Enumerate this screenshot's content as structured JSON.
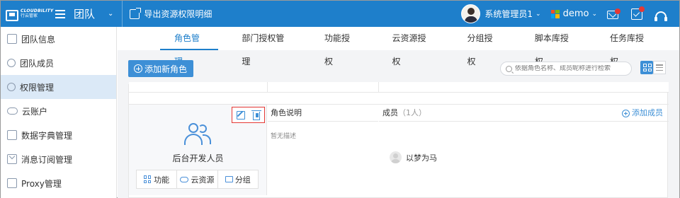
{
  "app": {
    "logo_en": "CLOUDBILITY",
    "logo_cn": "行云管家",
    "team_title": "团队",
    "export_label": "导出资源权限明细"
  },
  "user": {
    "name": "系统管理员1"
  },
  "org": {
    "name": "demo"
  },
  "colors": {
    "primary": "#1e7fcb",
    "accent": "#3d8fd6",
    "highlight": "#e53935"
  },
  "icons": {
    "menu": "hamburger-icon",
    "export": "export-icon",
    "mail": "mail-icon",
    "tasks": "task-icon",
    "support": "headset-icon"
  },
  "sidebar": {
    "items": [
      {
        "label": "团队信息",
        "icon": "document-icon"
      },
      {
        "label": "团队成员",
        "icon": "users-icon"
      },
      {
        "label": "权限管理",
        "icon": "user-gear-icon",
        "active": true
      },
      {
        "label": "云账户",
        "icon": "cloud-icon"
      },
      {
        "label": "数据字典管理",
        "icon": "book-icon"
      },
      {
        "label": "消息订阅管理",
        "icon": "mail-icon"
      },
      {
        "label": "Proxy管理",
        "icon": "proxy-icon"
      }
    ]
  },
  "tabs": [
    {
      "label": "角色管理",
      "active": true
    },
    {
      "label": "部门授权管理"
    },
    {
      "label": "功能授权"
    },
    {
      "label": "云资源授权"
    },
    {
      "label": "分组授权"
    },
    {
      "label": "脚本库授权"
    },
    {
      "label": "任务库授权"
    }
  ],
  "toolbar": {
    "add_role_label": "添加新角色",
    "search_placeholder": "依据角色名称、成员昵称进行检索"
  },
  "role_card": {
    "name": "后台开发人员",
    "buttons": [
      "功能",
      "云资源",
      "分组"
    ],
    "desc_header": "角色说明",
    "desc_value": "暂无描述",
    "members_header": "成员",
    "members_count": "（1人）",
    "add_member_label": "添加成员",
    "members": [
      "以梦为马"
    ]
  }
}
